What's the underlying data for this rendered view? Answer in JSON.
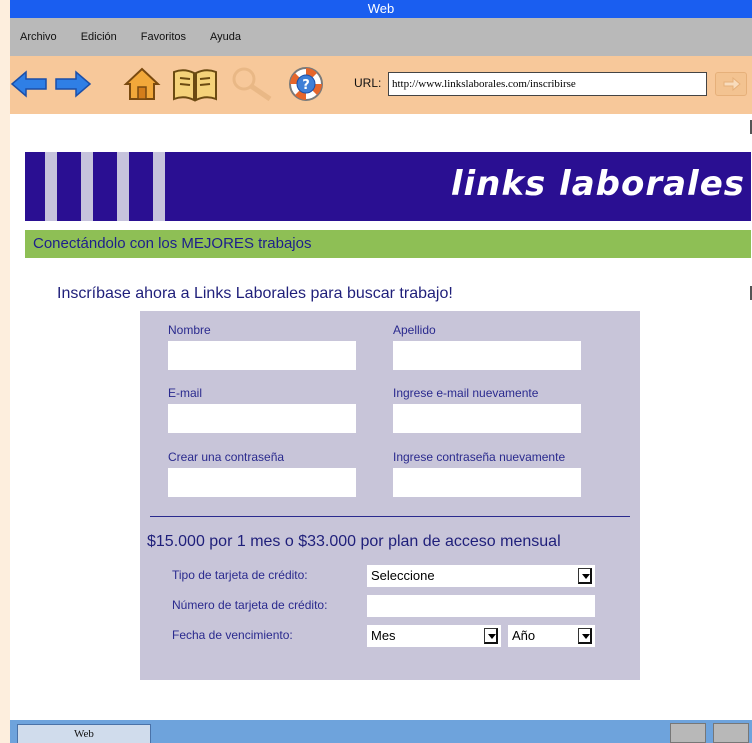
{
  "window": {
    "title": "Web"
  },
  "menu": [
    {
      "label": "Archivo"
    },
    {
      "label": "Edición"
    },
    {
      "label": "Favoritos"
    },
    {
      "label": "Ayuda"
    }
  ],
  "toolbar": {
    "icons": [
      "back-arrow-icon",
      "forward-arrow-icon",
      "home-icon",
      "bookmarks-book-icon",
      "search-magnifier-icon",
      "help-lifebuoy-icon"
    ],
    "url_label": "URL:",
    "url_value": "http://www.linkslaborales.com/inscribirse"
  },
  "site": {
    "logo": "links laborales",
    "tagline": "Conectándolo con los MEJORES trabajos",
    "signup_heading": "Inscríbase ahora a Links Laborales para buscar trabajo!",
    "colors": {
      "banner": "#2a0f92",
      "tagline_bar": "#8ebf55",
      "form_bg": "#c8c5d9",
      "text": "#2a2a8e"
    }
  },
  "form": {
    "first_name_label": "Nombre",
    "last_name_label": "Apellido",
    "email_label": "E-mail",
    "email_confirm_label": "Ingrese e-mail nuevamente",
    "password_label": "Crear una contraseña",
    "password_confirm_label": "Ingrese contraseña nuevamente",
    "price_text": "$15.000 por 1 mes o $33.000 por plan de acceso mensual",
    "card_type_label": "Tipo de tarjeta de crédito:",
    "card_type_value": "Seleccione",
    "card_number_label": "Número de tarjeta de crédito:",
    "expiry_label": "Fecha de vencimiento:",
    "month_value": "Mes",
    "year_value": "Año"
  },
  "taskbar": {
    "task_label": "Web"
  }
}
